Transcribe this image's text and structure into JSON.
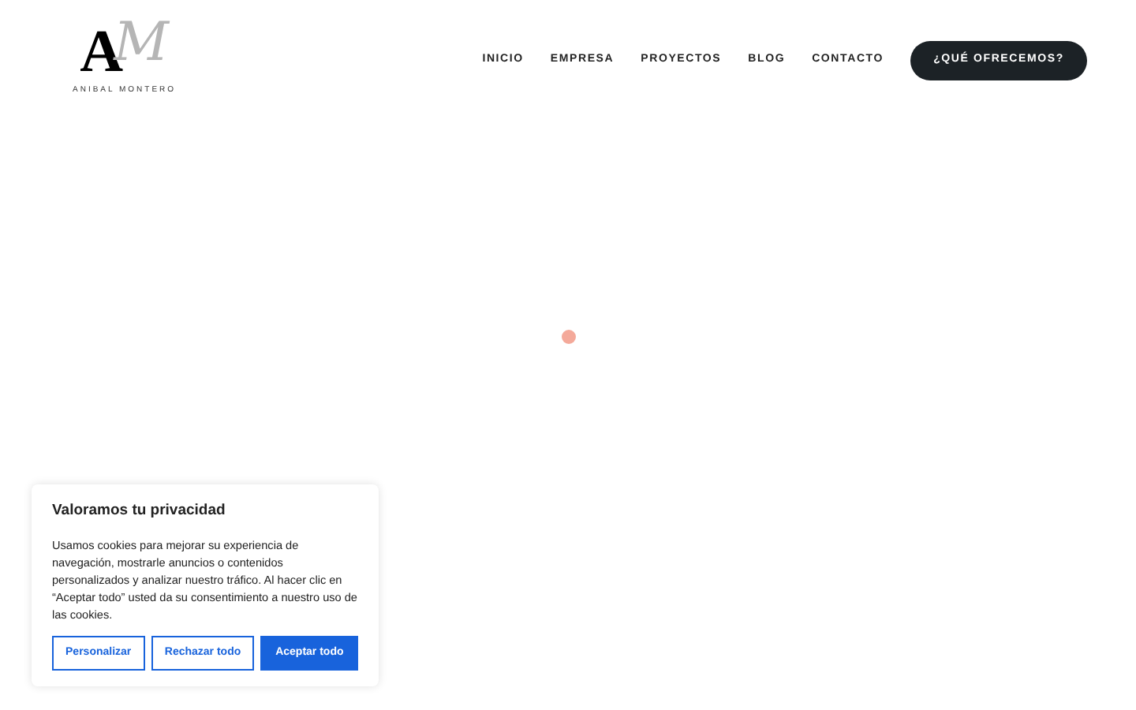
{
  "logo": {
    "letter_a": "A",
    "letter_m": "M",
    "name": "ANIBAL MONTERO"
  },
  "nav": {
    "items": [
      {
        "label": "INICIO"
      },
      {
        "label": "EMPRESA"
      },
      {
        "label": "PROYECTOS"
      },
      {
        "label": "BLOG"
      },
      {
        "label": "CONTACTO"
      }
    ],
    "cta": "¿QUÉ OFRECEMOS?"
  },
  "loader": {
    "color": "#f4a99a"
  },
  "cookie_banner": {
    "title": "Valoramos tu privacidad",
    "text": "Usamos cookies para mejorar su experiencia de navegación, mostrarle anuncios o contenidos personalizados y analizar nuestro tráfico. Al hacer clic en “Aceptar todo” usted da su consentimiento a nuestro uso de las cookies.",
    "buttons": [
      {
        "label": "Personalizar",
        "kind": "outline"
      },
      {
        "label": "Rechazar todo",
        "kind": "outline"
      },
      {
        "label": "Aceptar todo",
        "kind": "primary"
      }
    ]
  }
}
